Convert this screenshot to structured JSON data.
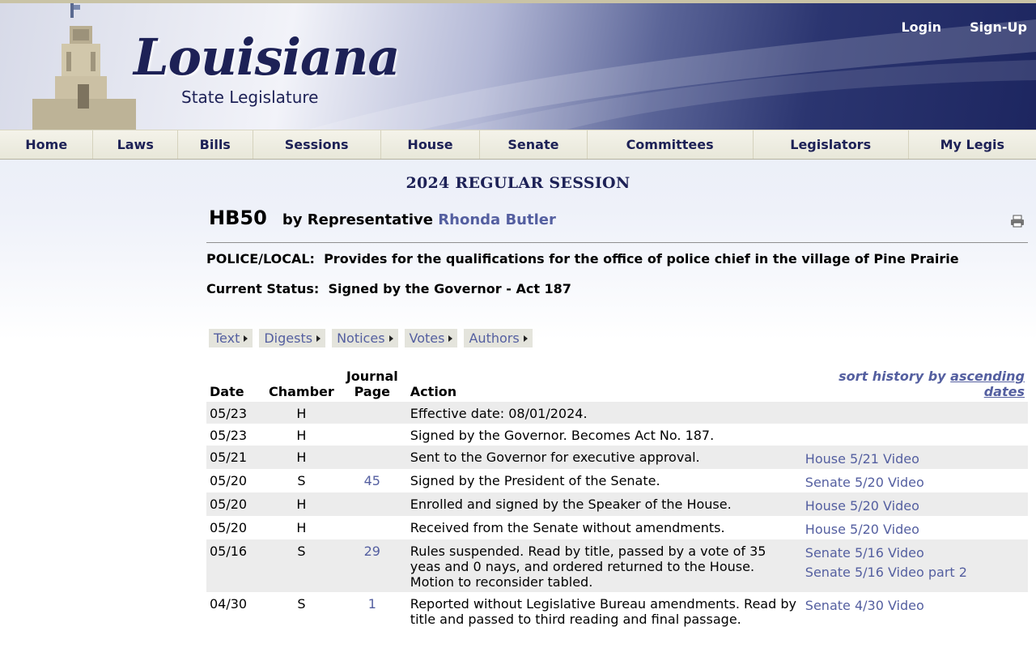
{
  "header": {
    "logo_main": "Louisiana",
    "logo_sub": "State Legislature",
    "login": "Login",
    "signup": "Sign-Up"
  },
  "nav": [
    "Home",
    "Laws",
    "Bills",
    "Sessions",
    "House",
    "Senate",
    "Committees",
    "Legislators",
    "My Legis"
  ],
  "session_title": "2024 REGULAR SESSION",
  "bill": {
    "number": "HB50",
    "by": "by Representative",
    "author": "Rhonda Butler",
    "title_label": "POLICE/LOCAL:",
    "title_text": "Provides for the qualifications for the office of police chief in the village of Pine Prairie",
    "status_label": "Current Status:",
    "status_text": "Signed by the Governor - Act 187"
  },
  "tabs": [
    "Text",
    "Digests",
    "Notices",
    "Votes",
    "Authors"
  ],
  "history": {
    "headers": {
      "date": "Date",
      "chamber": "Chamber",
      "journal_line1": "Journal",
      "journal_line2": "Page",
      "action": "Action",
      "sort_prefix": "sort history by",
      "sort_link": "ascending dates"
    },
    "rows": [
      {
        "date": "05/23",
        "chamber": "H",
        "page": "",
        "action": "Effective date: 08/01/2024.",
        "videos": []
      },
      {
        "date": "05/23",
        "chamber": "H",
        "page": "",
        "action": "Signed by the Governor. Becomes Act No. 187.",
        "videos": []
      },
      {
        "date": "05/21",
        "chamber": "H",
        "page": "",
        "action": "Sent to the Governor for executive approval.",
        "videos": [
          "House 5/21 Video"
        ]
      },
      {
        "date": "05/20",
        "chamber": "S",
        "page": "45",
        "action": "Signed by the President of the Senate.",
        "videos": [
          "Senate 5/20 Video"
        ]
      },
      {
        "date": "05/20",
        "chamber": "H",
        "page": "",
        "action": "Enrolled and signed by the Speaker of the House.",
        "videos": [
          "House 5/20 Video"
        ]
      },
      {
        "date": "05/20",
        "chamber": "H",
        "page": "",
        "action": "Received from the Senate without amendments.",
        "videos": [
          "House 5/20 Video"
        ]
      },
      {
        "date": "05/16",
        "chamber": "S",
        "page": "29",
        "action": "Rules suspended. Read by title, passed by a vote of 35 yeas and 0 nays, and ordered returned to the House. Motion to reconsider tabled.",
        "videos": [
          "Senate 5/16 Video",
          "Senate 5/16 Video part 2"
        ]
      },
      {
        "date": "04/30",
        "chamber": "S",
        "page": "1",
        "action": "Reported without Legislative Bureau amendments. Read by title and passed to third reading and final passage.",
        "videos": [
          "Senate 4/30 Video"
        ]
      }
    ]
  }
}
